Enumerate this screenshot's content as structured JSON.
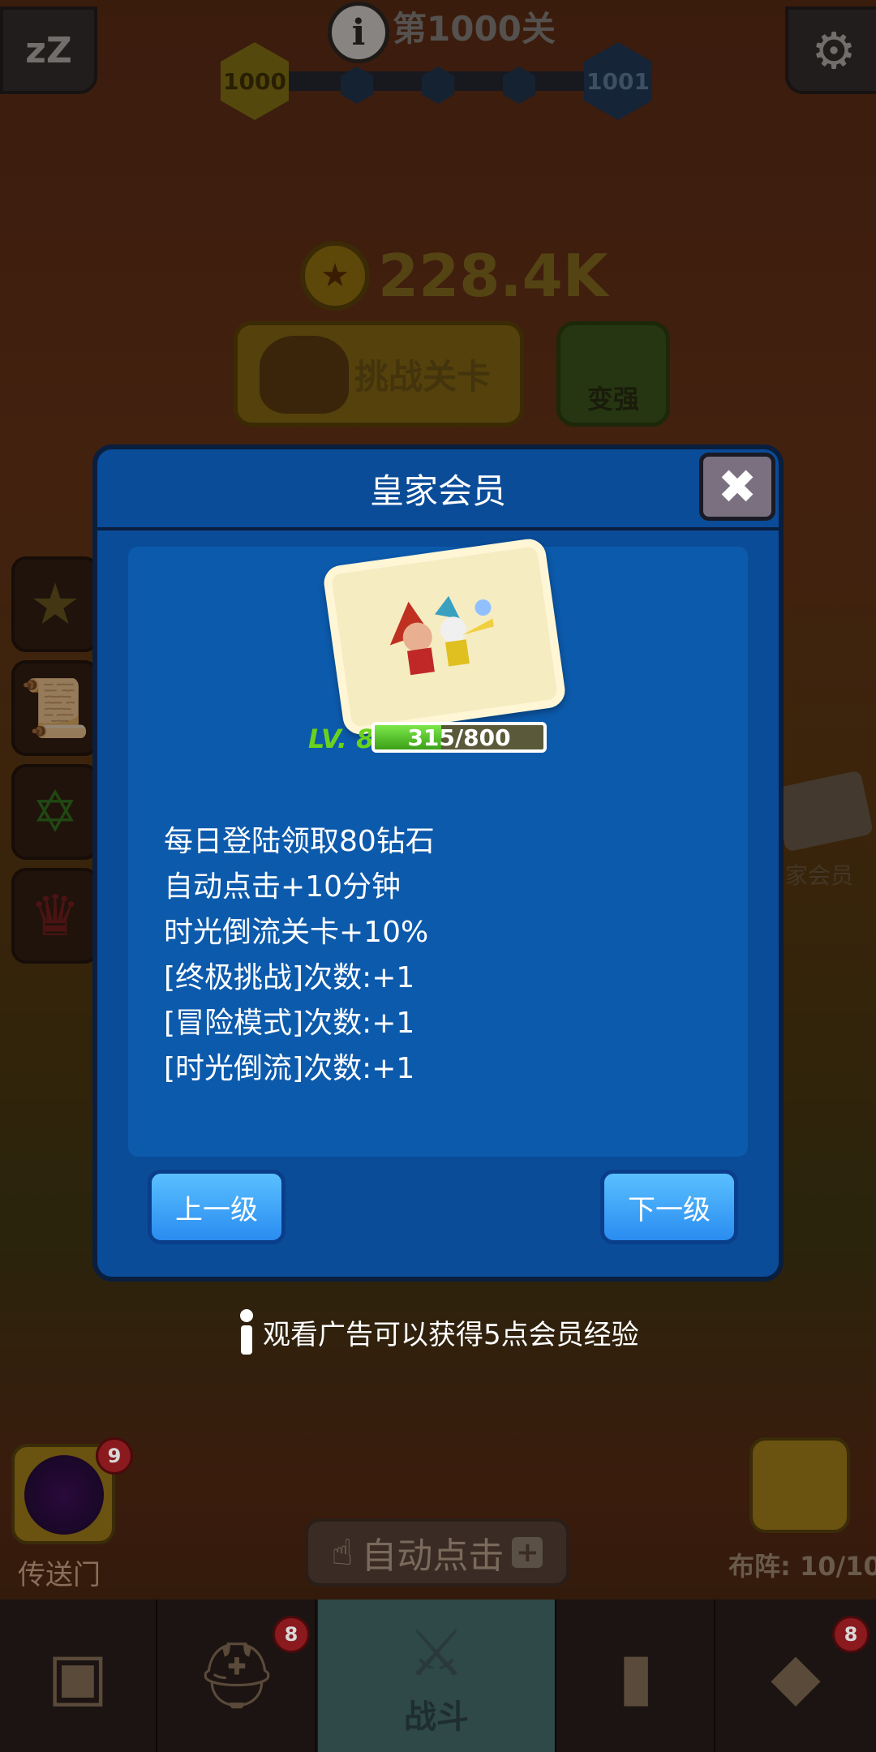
{
  "top_bar": {
    "sleep_icon": "zzz-icon",
    "level_title": "第1000关",
    "current_level": "1000",
    "next_level": "1001",
    "settings_icon": "gear-icon"
  },
  "currency": {
    "coins": "228.4K"
  },
  "actions": {
    "challenge_label": "挑战关卡",
    "strengthen_label": "变强"
  },
  "side": {
    "royal_member_label": "家会员"
  },
  "modal": {
    "title": "皇家会员",
    "level_label": "LV. 8",
    "exp_text": "315/800",
    "exp_fraction": 0.39375,
    "perks": [
      "每日登陆领取80钻石",
      "自动点击+10分钟",
      "时光倒流关卡+10%",
      "[终极挑战]次数:+1",
      "[冒险模式]次数:+1",
      "[时光倒流]次数:+1"
    ],
    "prev_label": "上一级",
    "next_label": "下一级",
    "close_icon": "close-icon"
  },
  "ad_tip": "观看广告可以获得5点会员经验",
  "lower": {
    "portal_label": "传送门",
    "portal_badge": "9",
    "auto_click_label": "自动点击",
    "formation_label": "布阵: 10/10"
  },
  "bottom_nav": {
    "hero_badge": "8",
    "necklace_badge": "8",
    "battle_label": "战斗"
  },
  "colors": {
    "modal_bg": "#0a4c98",
    "button_blue": "#2a8cf0",
    "level_green": "#6ad21c"
  }
}
